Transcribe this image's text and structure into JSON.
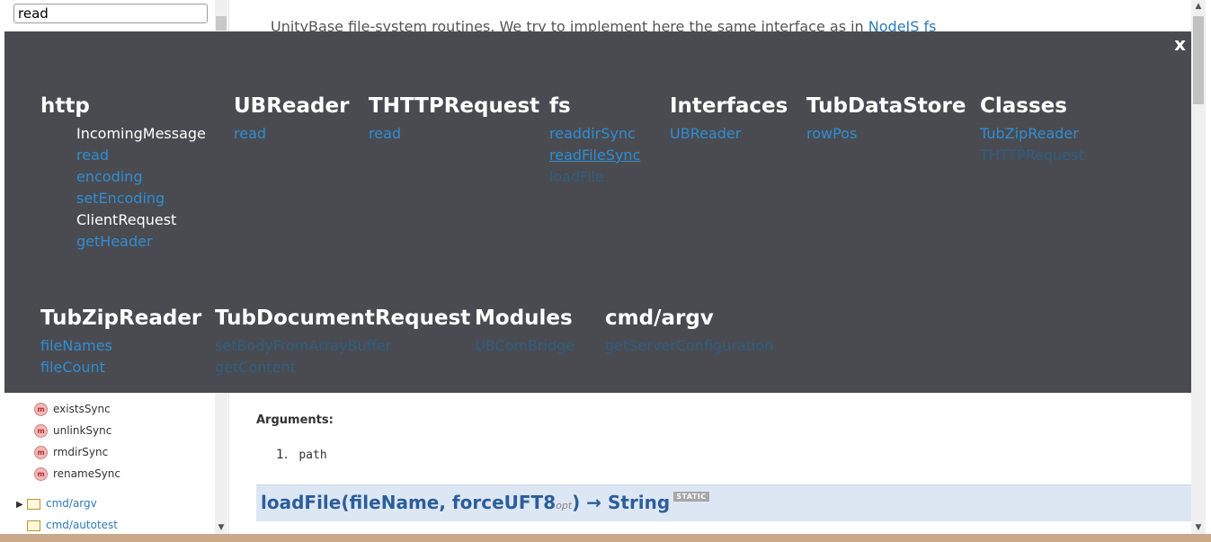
{
  "search": {
    "value": "read"
  },
  "sidebar": {
    "members": [
      "existsSync",
      "unlinkSync",
      "rmdirSync",
      "renameSync"
    ],
    "member_badge": "m",
    "tree": [
      {
        "label": "cmd/argv",
        "expandable": true
      },
      {
        "label": "cmd/autotest",
        "expandable": false
      }
    ]
  },
  "main": {
    "intro_text": "UnityBase file-system routines. We try to implement here the same interface as in",
    "intro_link": "NodeJS fs",
    "arguments_label": "Arguments:",
    "args": [
      {
        "num": "1.",
        "name": "path"
      }
    ],
    "method": {
      "name": "loadFile(fileName, forceUFT8",
      "opt": "opt",
      "close": ") → String",
      "badge": "STATIC"
    }
  },
  "overlay": {
    "close_label": "x",
    "groups": [
      {
        "title": "http",
        "items": [
          {
            "label": "IncomingMessage",
            "style": "white"
          },
          {
            "label": "read",
            "style": "link"
          },
          {
            "label": "encoding",
            "style": "link"
          },
          {
            "label": "setEncoding",
            "style": "link"
          },
          {
            "label": "ClientRequest",
            "style": "white"
          },
          {
            "label": "getHeader",
            "style": "link"
          }
        ]
      },
      {
        "title": "UBReader",
        "items": [
          {
            "label": "read",
            "style": "link"
          }
        ]
      },
      {
        "title": "THTTPRequest",
        "items": [
          {
            "label": "read",
            "style": "link"
          }
        ]
      },
      {
        "title": "fs",
        "items": [
          {
            "label": "readdirSync",
            "style": "link"
          },
          {
            "label": "readFileSync",
            "style": "link-underline"
          },
          {
            "label": "loadFile",
            "style": "dim"
          }
        ]
      },
      {
        "title": "Interfaces",
        "items": [
          {
            "label": "UBReader",
            "style": "link"
          }
        ]
      },
      {
        "title": "TubDataStore",
        "items": [
          {
            "label": "rowPos",
            "style": "link"
          }
        ]
      },
      {
        "title": "Classes",
        "items": [
          {
            "label": "TubZipReader",
            "style": "link"
          },
          {
            "label": "THTTPRequest",
            "style": "dim"
          }
        ]
      },
      {
        "title": "TubZipReader",
        "items": [
          {
            "label": "fileNames",
            "style": "link"
          },
          {
            "label": "fileCount",
            "style": "link"
          }
        ]
      },
      {
        "title": "TubDocumentRequest",
        "items": [
          {
            "label": "setBodyFromArrayBuffer",
            "style": "dim"
          },
          {
            "label": "getContent",
            "style": "dim"
          }
        ]
      },
      {
        "title": "Modules",
        "items": [
          {
            "label": "UBComBridge",
            "style": "dim"
          }
        ]
      },
      {
        "title": "cmd/argv",
        "items": [
          {
            "label": "getServerConfiguration",
            "style": "dim"
          }
        ]
      }
    ]
  }
}
